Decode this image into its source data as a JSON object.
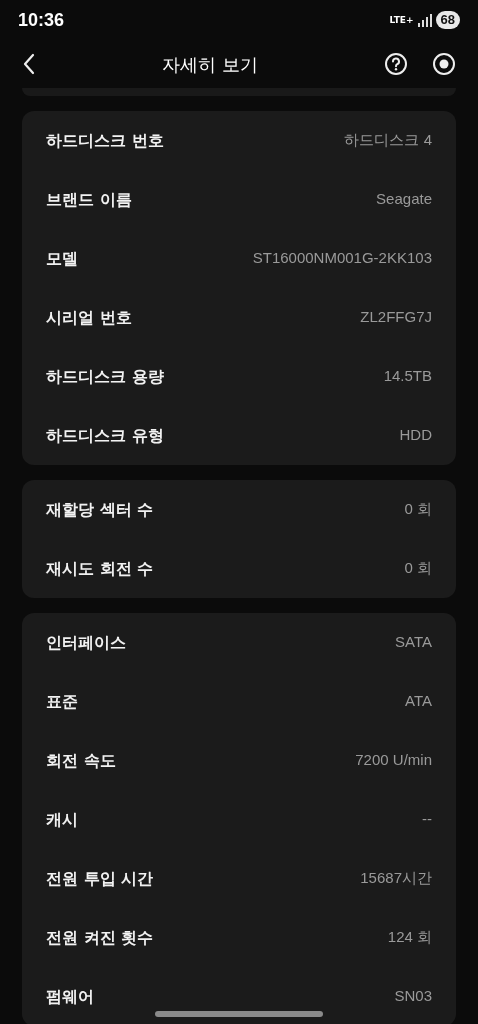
{
  "status_bar": {
    "time": "10:36",
    "network": "LTE+",
    "battery": "68"
  },
  "header": {
    "title": "자세히 보기"
  },
  "sections": [
    {
      "rows": [
        {
          "label": "하드디스크 번호",
          "value": "하드디스크 4"
        },
        {
          "label": "브랜드 이름",
          "value": "Seagate"
        },
        {
          "label": "모델",
          "value": "ST16000NM001G-2KK103"
        },
        {
          "label": "시리얼 번호",
          "value": "ZL2FFG7J"
        },
        {
          "label": "하드디스크 용량",
          "value": "14.5TB"
        },
        {
          "label": "하드디스크 유형",
          "value": "HDD"
        }
      ]
    },
    {
      "rows": [
        {
          "label": "재할당 섹터 수",
          "value": "0 회"
        },
        {
          "label": "재시도 회전 수",
          "value": "0 회"
        }
      ]
    },
    {
      "rows": [
        {
          "label": "인터페이스",
          "value": "SATA"
        },
        {
          "label": "표준",
          "value": "ATA"
        },
        {
          "label": "회전 속도",
          "value": "7200 U/min"
        },
        {
          "label": "캐시",
          "value": "--"
        },
        {
          "label": "전원 투입 시간",
          "value": "15687시간"
        },
        {
          "label": "전원 켜진 횟수",
          "value": "124 회"
        },
        {
          "label": "펌웨어",
          "value": "SN03"
        }
      ]
    }
  ]
}
